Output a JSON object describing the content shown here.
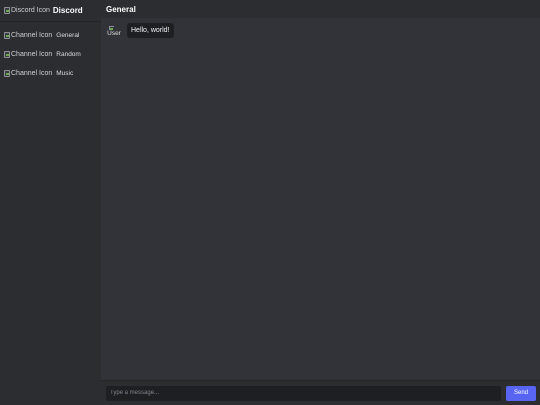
{
  "sidebar": {
    "logo_alt": "Discord Icon",
    "title": "Discord",
    "channels": [
      {
        "icon_alt": "Channel Icon",
        "label": "General"
      },
      {
        "icon_alt": "Channel Icon",
        "label": "Random"
      },
      {
        "icon_alt": "Channel Icon",
        "label": "Music"
      }
    ]
  },
  "main": {
    "channel_title": "General",
    "messages": [
      {
        "avatar_alt": "User",
        "text": "Hello, world!"
      }
    ]
  },
  "composer": {
    "placeholder": "Type a message...",
    "send_label": "Send"
  },
  "colors": {
    "sidebar_bg": "#2b2d31",
    "main_bg": "#313338",
    "input_bg": "#1e1f22",
    "accent": "#5865f2"
  }
}
